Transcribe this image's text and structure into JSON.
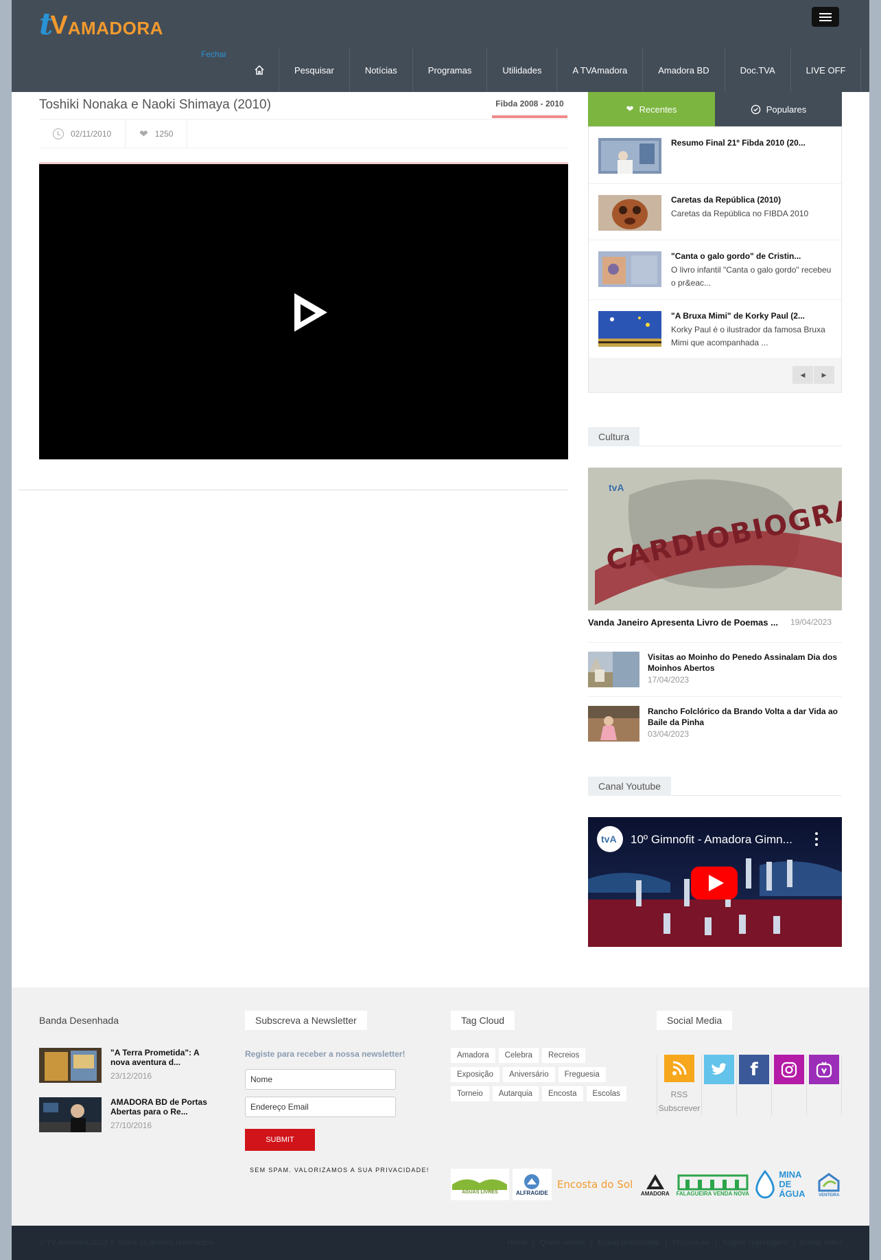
{
  "logo": {
    "t": "t",
    "v": "V",
    "rest": "AMADORA"
  },
  "header": {
    "fechar": "Fechar"
  },
  "nav": [
    "Pesquisar",
    "Notícias",
    "Programas",
    "Utilidades",
    "A TVAmadora",
    "Amadora BD",
    "Doc.TVA",
    "LIVE OFF"
  ],
  "article": {
    "title": "Toshiki Nonaka e Naoki Shimaya (2010)",
    "category": "Fibda 2008 - 2010",
    "date": "02/11/2010",
    "likes": "1250"
  },
  "tabs": {
    "recentes": "Recentes",
    "populares": "Populares"
  },
  "recent": [
    {
      "title": "Resumo Final 21º Fibda 2010 (20...",
      "desc": ""
    },
    {
      "title": "Caretas da República (2010)",
      "desc": "Caretas da República no FIBDA 2010"
    },
    {
      "title": "\"Canta o galo gordo\" de Cristin...",
      "desc": "O livro infantil \"Canta o galo gordo\" recebeu o pr&eac..."
    },
    {
      "title": "\"A Bruxa Mimi\" de Korky Paul (2...",
      "desc": "Korky Paul é o ilustrador da famosa Bruxa Mimi que acompanhada ..."
    }
  ],
  "cultura": {
    "head": "Cultura",
    "image_text": "CARDIOBIOGRAFIA",
    "image_logo": "tvA",
    "featured": {
      "title": "Vanda Janeiro Apresenta Livro de Poemas ...",
      "date": "19/04/2023"
    },
    "items": [
      {
        "title": "Visitas ao Moinho do Penedo Assinalam Dia dos Moinhos Abertos",
        "date": "17/04/2023"
      },
      {
        "title": "Rancho Folclórico da Brando Volta a dar Vida ao Baile da Pinha",
        "date": "03/04/2023"
      }
    ]
  },
  "youtube": {
    "head": "Canal Youtube",
    "video_title": "10º Gimnofit - Amadora Gimn...",
    "channel_logo": "tvA"
  },
  "footer": {
    "bd_head": "Banda Desenhada",
    "bd": [
      {
        "title": "\"A Terra Prometida\": A nova aventura d...",
        "date": "23/12/2016"
      },
      {
        "title": "AMADORA BD de Portas Abertas para o Re...",
        "date": "27/10/2016"
      }
    ],
    "newsletter_head": "Subscreva a Newsletter",
    "newsletter_label": "Registe para receber a nossa newsletter!",
    "name_placeholder": "Nome",
    "email_placeholder": "Endereço Email",
    "submit": "SUBMIT",
    "nospam": "SEM SPAM. VALORIZAMOS A SUA PRIVACIDADE!",
    "tags_head": "Tag Cloud",
    "tags": [
      "Amadora",
      "Celebra",
      "Recreios",
      "Exposição",
      "Aniversário",
      "Freguesia",
      "Torneio",
      "Autarquia",
      "Encosta",
      "Escolas"
    ],
    "social_head": "Social Media",
    "rss_label": "RSS",
    "rss_sub": "Subscrever",
    "partners": [
      "ÁGUAS LIVRES",
      "ALFRAGIDE",
      "Encosta do Sol",
      "AMADORA",
      "FALAGUEIRA VENDA NOVA",
      "MINA DE ÁGUA",
      "VENTEIRA"
    ],
    "copyright": "© TV Amadora 2023 ® Todos os direitos reservados",
    "links": [
      "Home",
      "Quem somos",
      "Enviar publicidade",
      "Procura-se",
      "Sugerir reportagem",
      "Enviar video"
    ]
  },
  "colors": {
    "header": "#434d58",
    "accent_green": "#7cb540",
    "submit_red": "#d0141a",
    "link_blue": "#2a93d5",
    "logo_orange": "#f29a2e"
  }
}
